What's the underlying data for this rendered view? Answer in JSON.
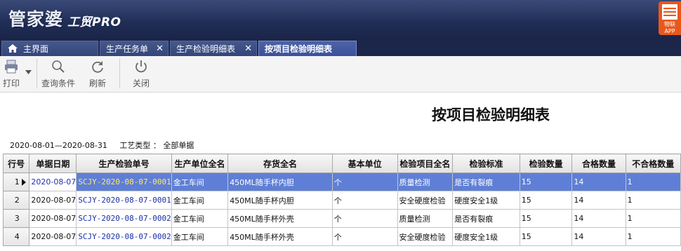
{
  "app": {
    "logo_main": "管家婆",
    "logo_sub": "工贸PRO",
    "promo_line1": "物联",
    "promo_line2": "APP"
  },
  "tabs": [
    {
      "label": "主界面",
      "icon": "home-icon"
    },
    {
      "label": "生产任务单"
    },
    {
      "label": "生产检验明细表"
    },
    {
      "label": "按项目检验明细表"
    }
  ],
  "toolbar": {
    "print": "打印",
    "query": "查询条件",
    "refresh": "刷新",
    "close": "关闭"
  },
  "report": {
    "title": "按项目检验明细表",
    "date_range": "2020-08-01—2020-08-31",
    "process_type": "工艺类型 ： 全部单据"
  },
  "grid": {
    "columns": [
      "行号",
      "单据日期",
      "生产检验单号",
      "生产单位全名",
      "存货全名",
      "基本单位",
      "检验项目全名",
      "检验标准",
      "检验数量",
      "合格数量",
      "不合格数量"
    ],
    "rows": [
      {
        "num": "1",
        "date": "2020-08-07",
        "code": "SCJY-2020-08-07-0001",
        "unit": "金工车间",
        "item": "450ML随手杯内胆",
        "base_unit": "个",
        "project": "质量检测",
        "standard": "是否有裂痕",
        "qty": "15",
        "pass": "14",
        "fail": "1"
      },
      {
        "num": "2",
        "date": "2020-08-07",
        "code": "SCJY-2020-08-07-0001",
        "unit": "金工车间",
        "item": "450ML随手杯内胆",
        "base_unit": "个",
        "project": "安全硬度检验",
        "standard": "硬度安全1级",
        "qty": "15",
        "pass": "14",
        "fail": "1"
      },
      {
        "num": "3",
        "date": "2020-08-07",
        "code": "SCJY-2020-08-07-0002",
        "unit": "金工车间",
        "item": "450ML随手杯外壳",
        "base_unit": "个",
        "project": "质量检测",
        "standard": "是否有裂痕",
        "qty": "15",
        "pass": "14",
        "fail": "1"
      },
      {
        "num": "4",
        "date": "2020-08-07",
        "code": "SCJY-2020-08-07-0002",
        "unit": "金工车间",
        "item": "450ML随手杯外壳",
        "base_unit": "个",
        "project": "安全硬度检验",
        "standard": "硬度安全1级",
        "qty": "15",
        "pass": "14",
        "fail": "1"
      }
    ],
    "selected_row": 1
  }
}
